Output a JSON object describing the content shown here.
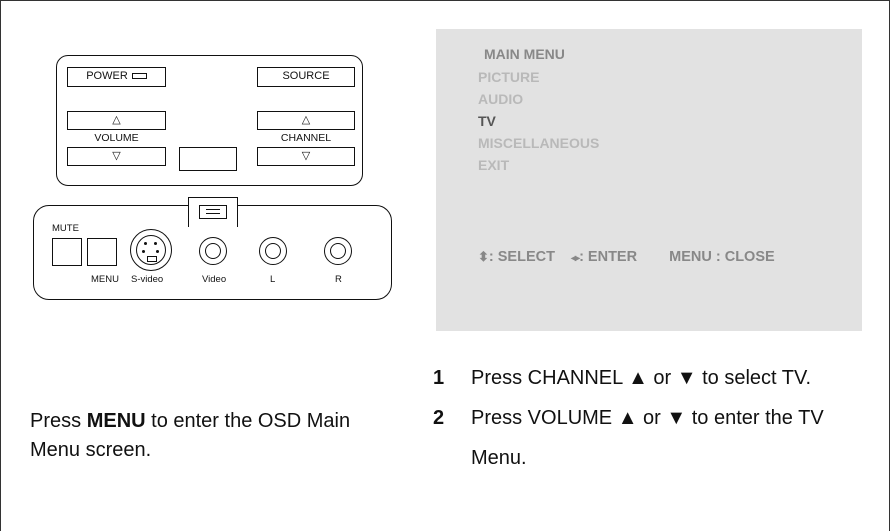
{
  "panel": {
    "power_label": "POWER",
    "source_label": "SOURCE",
    "volume_label": "VOLUME",
    "channel_label": "CHANNEL",
    "up_symbol": "△",
    "down_symbol": "▽",
    "mute_label": "MUTE",
    "menu_label": "MENU",
    "svideo_label": "S-video",
    "video_label": "Video",
    "l_label": "L",
    "r_label": "R"
  },
  "osd": {
    "title": "MAIN MENU",
    "items": [
      {
        "label": "PICTURE",
        "selected": false
      },
      {
        "label": "AUDIO",
        "selected": false
      },
      {
        "label": "TV",
        "selected": true
      },
      {
        "label": "MISCELLANEOUS",
        "selected": false
      },
      {
        "label": "EXIT",
        "selected": false
      }
    ],
    "footer": {
      "select_icon": "⬍",
      "select_text": ": SELECT",
      "enter_icon": "◂▸",
      "enter_text": ": ENTER",
      "close_text": "MENU : CLOSE"
    }
  },
  "instructions": {
    "left_prefix": "Press ",
    "left_bold": "MENU",
    "left_suffix": " to enter the OSD Main Menu screen.",
    "steps": [
      {
        "num": "1",
        "text": "Press CHANNEL ▲ or ▼ to select TV."
      },
      {
        "num": "2",
        "text": "Press VOLUME ▲ or ▼ to enter the TV Menu."
      }
    ]
  }
}
